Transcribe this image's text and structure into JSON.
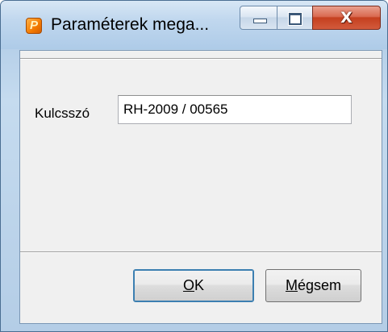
{
  "window": {
    "title": "Paraméterek mega...",
    "icon_letter": "P",
    "close_glyph": "X"
  },
  "form": {
    "key_label": "Kulcsszó",
    "key_value": "RH-2009 / 00565"
  },
  "buttons": {
    "ok_accel": "O",
    "ok_rest": "K",
    "cancel_accel": "M",
    "cancel_rest": "égsem"
  },
  "icons": {
    "app": "app-logo-icon",
    "minimize": "minimize-icon",
    "maximize": "maximize-icon",
    "close": "close-icon"
  },
  "colors": {
    "close_button": "#c5401f",
    "titlebar": "#c0d7ee",
    "client_bg": "#f0f0f0",
    "default_button_border": "#3c7fb1"
  }
}
